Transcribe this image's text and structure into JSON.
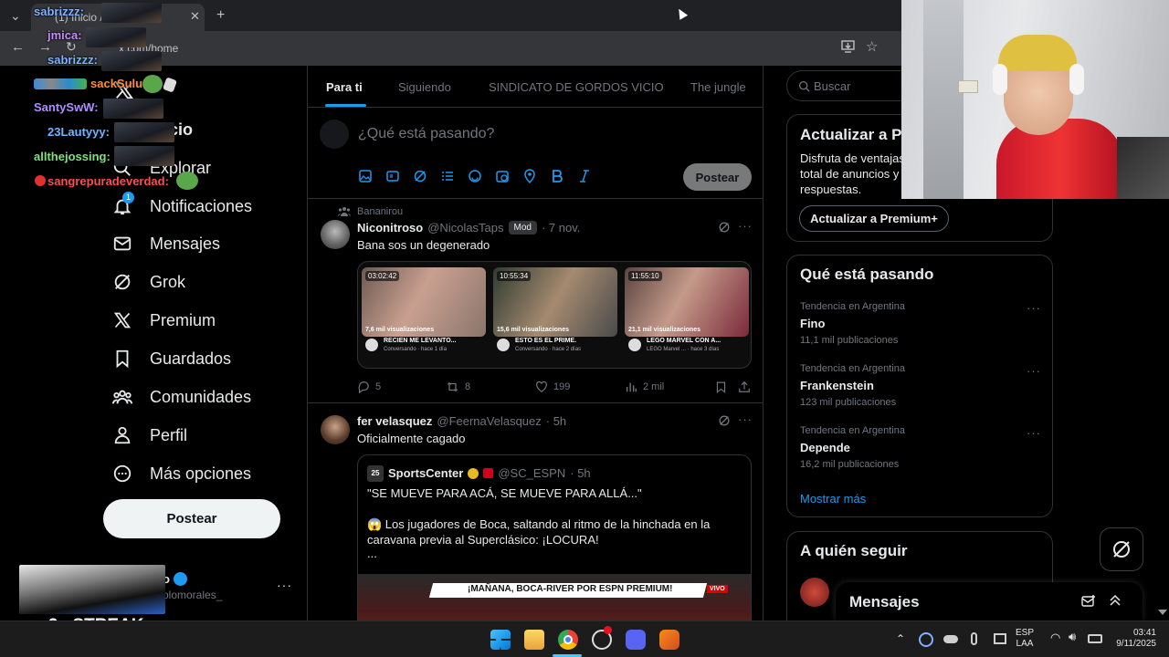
{
  "browser": {
    "tab_title": "(1) Inicio / X",
    "url": "x.com/home"
  },
  "nav": {
    "items": [
      {
        "label": "Inicio"
      },
      {
        "label": "Explorar"
      },
      {
        "label": "Notificaciones",
        "badge": "1"
      },
      {
        "label": "Mensajes"
      },
      {
        "label": "Grok"
      },
      {
        "label": "Premium"
      },
      {
        "label": "Guardados"
      },
      {
        "label": "Comunidades"
      },
      {
        "label": "Perfil"
      },
      {
        "label": "Más opciones"
      }
    ],
    "post_button": "Postear",
    "account": {
      "name_partial": "o",
      "handle_partial": "olomorales_"
    }
  },
  "feed": {
    "tabs": [
      "Para ti",
      "Siguiendo",
      "SINDICATO DE GORDOS VICIO",
      "The jungle"
    ],
    "composer_placeholder": "¿Qué está pasando?",
    "composer_post": "Postear",
    "tweets": [
      {
        "context": "Bananirou",
        "name": "Niconitroso",
        "handle": "@NicolasTaps",
        "badge": "Mod",
        "time": "· 7 nov.",
        "text": "Bana sos un degenerado",
        "thumbs": [
          {
            "time": "03:02:42",
            "views": "7,6 mil visualizaciones",
            "title": "RECIEN ME LEVANTO...",
            "sub": "Conversando · hace 1 día"
          },
          {
            "time": "10:55:34",
            "views": "15,6 mil visualizaciones",
            "title": "ESTO ES EL PRIME.",
            "sub": "Conversando · hace 2 días"
          },
          {
            "time": "11:55:10",
            "views": "21,1 mil visualizaciones",
            "title": "LEGO MARVEL CON A...",
            "sub": "LEGO Marvel ... · hace 3 días"
          }
        ],
        "replies": "5",
        "reposts": "8",
        "likes": "199",
        "views": "2 mil"
      },
      {
        "name": "fer velasquez",
        "handle": "@FeernaVelasquez",
        "time": "· 5h",
        "text": "Oficialmente cagado",
        "quote": {
          "name": "SportsCenter",
          "handle": "@SC_ESPN",
          "time": "· 5h",
          "line1": "\"SE MUEVE PARA ACÁ, SE MUEVE PARA ALLÁ...\"",
          "line2": "😱 Los jugadores de Boca, saltando al ritmo de la hinchada en la",
          "line3": "caravana previa al Superclásico: ¡LOCURA!",
          "line4": "...",
          "media_banner": "¡MAÑANA, BOCA-RIVER POR ESPN PREMIUM!",
          "media_live": "VIVO"
        }
      }
    ]
  },
  "sidebar": {
    "search_placeholder": "Buscar",
    "premium": {
      "title": "Actualizar a P",
      "text1": "Disfruta de ventajas",
      "text2": "total de anuncios y",
      "text3": "respuestas.",
      "button": "Actualizar a Premium+"
    },
    "trends": {
      "title": "Qué está pasando",
      "items": [
        {
          "meta": "Tendencia en Argentina",
          "name": "Fino",
          "count": "11,1 mil publicaciones"
        },
        {
          "meta": "Tendencia en Argentina",
          "name": "Frankenstein",
          "count": "123 mil publicaciones"
        },
        {
          "meta": "Tendencia en Argentina",
          "name": "Depende",
          "count": "16,2 mil publicaciones"
        }
      ],
      "more": "Mostrar más"
    },
    "follow": {
      "title": "A quién seguir"
    },
    "messages_drawer": "Mensajes"
  },
  "chat": [
    {
      "user": "sabrizzz:",
      "color": "#7fb3ff"
    },
    {
      "user": "jmica:",
      "color": "#c38cff"
    },
    {
      "user": "sabrizzz:",
      "color": "#7fb3ff"
    },
    {
      "user": "sackSulu:",
      "color": "#ff8c3a"
    },
    {
      "user": "SantySwW:",
      "color": "#b18cff"
    },
    {
      "user": "23Lautyyy:",
      "color": "#6ab7ff"
    },
    {
      "user": "allthejossing:",
      "color": "#7ee07e"
    },
    {
      "user": "sangrepuradeverdad:",
      "color": "#ff4d4d"
    }
  ],
  "overlay": {
    "streak": "9x STREAK"
  },
  "taskbar": {
    "lang1": "ESP",
    "lang2": "LAA",
    "time": "03:41",
    "date": "9/11/2025"
  }
}
